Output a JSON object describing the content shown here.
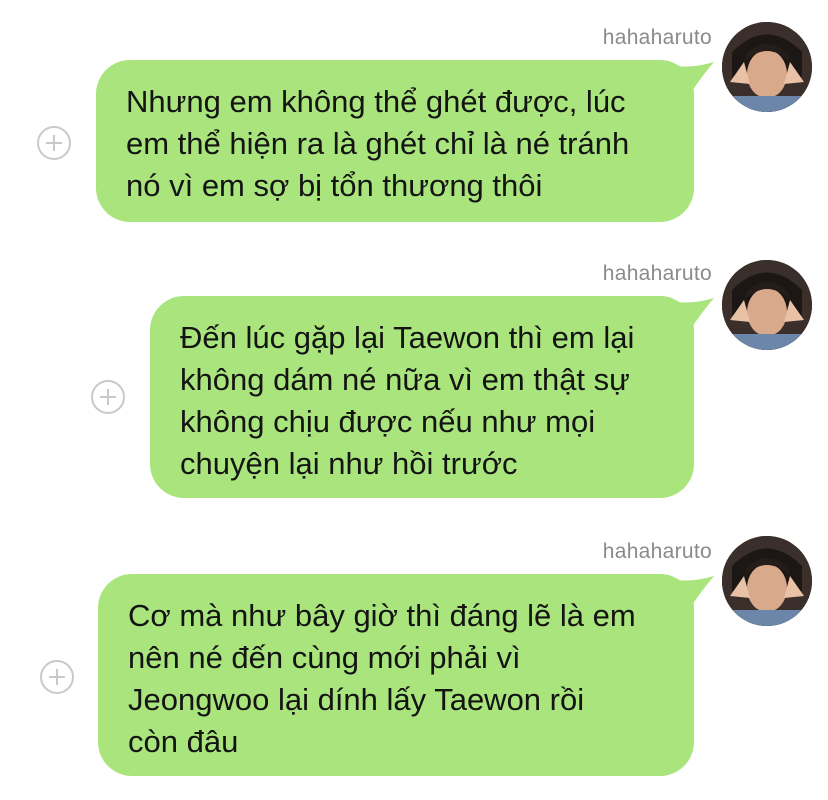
{
  "messages": [
    {
      "sender": "hahaharuto",
      "lines": [
        "Nhưng em không thể ghét được, lúc",
        "em thể hiện ra là ghét chỉ là né tránh",
        "nó vì em sợ bị tổn thương thôi"
      ]
    },
    {
      "sender": "hahaharuto",
      "lines": [
        "Đến lúc gặp lại Taewon thì em lại",
        "không dám né nữa vì em thật sự",
        "không chịu được nếu như mọi",
        "chuyện lại như hồi trước"
      ]
    },
    {
      "sender": "hahaharuto",
      "lines": [
        "Cơ mà như bây giờ thì đáng lẽ là em",
        "nên né đến cùng mới phải vì",
        "Jeongwoo lại dính lấy Taewon rồi",
        "còn đâu"
      ]
    }
  ],
  "colors": {
    "bubble": "#a9e57c",
    "sender_name": "#8a8a8a",
    "plus_icon": "#c9c9c9"
  },
  "icons": {
    "avatar": "profile-photo",
    "action": "add-circle-icon"
  }
}
